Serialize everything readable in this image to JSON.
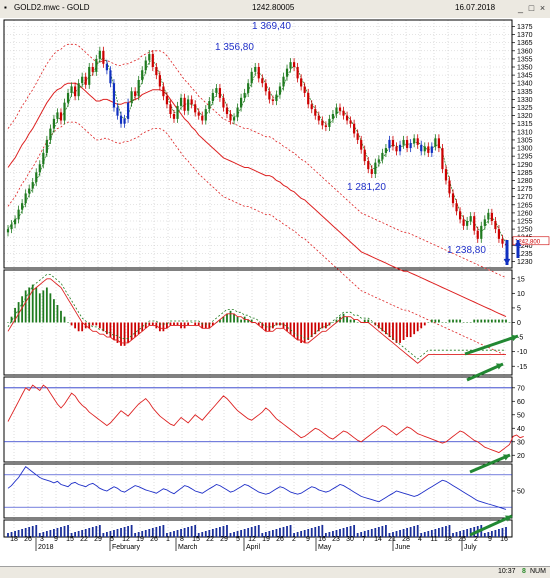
{
  "window": {
    "title": "GOLD2.mwc - GOLD",
    "price_readout": "1242.80005",
    "date_readout": "16.07.2018",
    "minimize_icon": "minimize-icon",
    "restore_icon": "restore-icon",
    "close_icon": "close-icon"
  },
  "status_bar": {
    "time": "10:37",
    "indicator_value": "8",
    "mode": "NUM"
  },
  "chart_data": [
    {
      "type": "candlestick",
      "title": "",
      "price_axis_ticks": [
        1230,
        1235,
        1240,
        1245,
        1250,
        1255,
        1260,
        1265,
        1270,
        1275,
        1280,
        1285,
        1290,
        1295,
        1300,
        1305,
        1310,
        1315,
        1320,
        1325,
        1330,
        1335,
        1340,
        1345,
        1350,
        1355,
        1360,
        1365,
        1370,
        1375
      ],
      "ylim": [
        1226,
        1379
      ],
      "current_price_label": "1242.800",
      "annotations": [
        {
          "text": "1 369,40",
          "value": 1369.4
        },
        {
          "text": "1 356,80",
          "value": 1356.8
        },
        {
          "text": "1 281,20",
          "value": 1281.2
        },
        {
          "text": "1 238,80",
          "value": 1238.8
        }
      ],
      "close": [
        1250,
        1253,
        1256,
        1262,
        1266,
        1272,
        1275,
        1279,
        1285,
        1290,
        1297,
        1305,
        1312,
        1318,
        1322,
        1317,
        1328,
        1334,
        1338,
        1332,
        1340,
        1344,
        1339,
        1350,
        1347,
        1355,
        1360,
        1352,
        1348,
        1340,
        1325,
        1320,
        1315,
        1318,
        1328,
        1335,
        1332,
        1342,
        1348,
        1354,
        1358,
        1350,
        1345,
        1338,
        1332,
        1327,
        1321,
        1318,
        1326,
        1331,
        1323,
        1330,
        1327,
        1322,
        1320,
        1317,
        1324,
        1329,
        1334,
        1337,
        1331,
        1325,
        1321,
        1317,
        1319,
        1325,
        1331,
        1334,
        1340,
        1347,
        1350,
        1343,
        1340,
        1335,
        1330,
        1329,
        1333,
        1338,
        1344,
        1349,
        1353,
        1350,
        1343,
        1338,
        1334,
        1327,
        1324,
        1320,
        1317,
        1314,
        1313,
        1318,
        1321,
        1325,
        1323,
        1320,
        1317,
        1315,
        1309,
        1305,
        1299,
        1292,
        1287,
        1284,
        1291,
        1293,
        1297,
        1300,
        1305,
        1301,
        1298,
        1302,
        1305,
        1300,
        1303,
        1306,
        1302,
        1298,
        1301,
        1297,
        1301,
        1306,
        1300,
        1287,
        1280,
        1272,
        1266,
        1261,
        1256,
        1252,
        1255,
        1258,
        1249,
        1244,
        1252,
        1256,
        1260,
        1255,
        1250,
        1244,
        1241,
        1240
      ],
      "middle_band": [
        1288,
        1291,
        1294,
        1298,
        1302,
        1305,
        1309,
        1312,
        1316,
        1320,
        1324,
        1328,
        1331,
        1334,
        1336,
        1337,
        1339,
        1340,
        1340,
        1340,
        1339,
        1337,
        1335,
        1333,
        1331,
        1329,
        1329,
        1330,
        1330,
        1329,
        1328,
        1327,
        1327,
        1328,
        1328,
        1329,
        1330,
        1331,
        1333,
        1334,
        1335,
        1336,
        1336,
        1336,
        1335,
        1333,
        1330,
        1327,
        1324,
        1321,
        1318,
        1316,
        1313,
        1311,
        1308,
        1306,
        1304,
        1302,
        1300,
        1298,
        1296,
        1294,
        1293,
        1292,
        1291,
        1290,
        1289,
        1288,
        1288,
        1287,
        1286,
        1285,
        1284,
        1283,
        1283,
        1282,
        1280,
        1279,
        1277,
        1276,
        1274,
        1273,
        1271,
        1269,
        1268,
        1266,
        1264,
        1262,
        1260,
        1258,
        1256,
        1254,
        1252,
        1250,
        1248,
        1246,
        1244,
        1242,
        1240,
        1238,
        1236,
        1235,
        1234,
        1233,
        1232,
        1231,
        1230,
        1229,
        1228,
        1227,
        1226,
        1225,
        1224,
        1224,
        1223,
        1222,
        1221,
        1220,
        1219,
        1218,
        1217,
        1216,
        1215,
        1214,
        1213,
        1212,
        1211,
        1210,
        1209,
        1208,
        1207,
        1206,
        1205,
        1204,
        1203,
        1202,
        1201,
        1200,
        1199,
        1198,
        1197,
        1196
      ]
    },
    {
      "type": "histogram",
      "name": "oscillator",
      "y_ticks": [
        15,
        10,
        5,
        0,
        -5,
        -10,
        -15
      ],
      "ylim": [
        -18,
        18
      ],
      "histogram": [
        0,
        2,
        5,
        7,
        9,
        11,
        12,
        13,
        12,
        10,
        11,
        12,
        10,
        8,
        6,
        4,
        2,
        0,
        -1,
        -2,
        -3,
        -3,
        -2,
        -2,
        -1,
        -1,
        -2,
        -3,
        -4,
        -5,
        -6,
        -7,
        -8,
        -8,
        -7,
        -6,
        -5,
        -4,
        -3,
        -2,
        -1,
        -1,
        -2,
        -3,
        -3,
        -2,
        -1,
        -1,
        -1,
        -2,
        -2,
        -1,
        0,
        -1,
        -1,
        -2,
        -2,
        -2,
        -1,
        0,
        1,
        2,
        3,
        4,
        3,
        2,
        1,
        2,
        1,
        1,
        0,
        -1,
        -2,
        -3,
        -3,
        -2,
        -1,
        -1,
        -2,
        -3,
        -4,
        -5,
        -6,
        -7,
        -7,
        -6,
        -5,
        -4,
        -3,
        -2,
        -2,
        -1,
        0,
        1,
        2,
        3,
        2,
        1,
        1,
        0,
        0,
        1,
        1,
        0,
        -1,
        -2,
        -3,
        -4,
        -5,
        -6,
        -7,
        -7,
        -6,
        -5,
        -5,
        -4,
        -3,
        -2,
        -1,
        0,
        1,
        1,
        1,
        0,
        0,
        1,
        1,
        1,
        1,
        0,
        0,
        0,
        1,
        1,
        1,
        1,
        1,
        1,
        1,
        1,
        1,
        1,
        0
      ],
      "signal": [
        -3,
        -1,
        1,
        3,
        5,
        7,
        9,
        11,
        12,
        13,
        14,
        15,
        15,
        14,
        13,
        12,
        10,
        8,
        6,
        4,
        2,
        0,
        -1,
        -2,
        -3,
        -3,
        -4,
        -4,
        -5,
        -5,
        -6,
        -6,
        -7,
        -7,
        -7,
        -6,
        -5,
        -4,
        -3,
        -2,
        -1,
        -1,
        -1,
        -2,
        -2,
        -2,
        -1,
        -1,
        -1,
        -1,
        -1,
        -1,
        -1,
        -1,
        -1,
        -2,
        -2,
        -2,
        -1,
        0,
        1,
        2,
        3,
        3,
        3,
        2,
        2,
        1,
        1,
        0,
        0,
        -1,
        -2,
        -3,
        -3,
        -3,
        -2,
        -2,
        -2,
        -3,
        -4,
        -5,
        -6,
        -6,
        -7,
        -7,
        -6,
        -5,
        -4,
        -3,
        -3,
        -2,
        -1,
        0,
        1,
        2,
        2,
        2,
        1,
        1,
        0,
        0,
        0,
        -1,
        -2,
        -3,
        -4,
        -5,
        -6,
        -7,
        -8,
        -9,
        -10,
        -11,
        -12,
        -13,
        -14,
        -13,
        -12,
        -11,
        -11,
        -11,
        -11,
        -11,
        -11,
        -11,
        -11,
        -11,
        -11,
        -11,
        -11,
        -11,
        -11,
        -11,
        -11,
        -11,
        -11,
        -11,
        -11,
        -11,
        -11,
        -11
      ]
    },
    {
      "type": "line",
      "name": "rsi",
      "y_ticks": [
        70,
        60,
        50,
        40,
        30,
        20
      ],
      "ylim": [
        15,
        78
      ],
      "levels": [
        70,
        30
      ],
      "values": [
        45,
        50,
        55,
        60,
        65,
        70,
        68,
        72,
        70,
        68,
        72,
        70,
        66,
        62,
        58,
        55,
        58,
        62,
        66,
        64,
        60,
        57,
        55,
        52,
        50,
        48,
        46,
        44,
        42,
        44,
        47,
        50,
        53,
        51,
        49,
        52,
        55,
        58,
        60,
        62,
        59,
        55,
        52,
        49,
        47,
        45,
        43,
        42,
        45,
        48,
        46,
        44,
        47,
        50,
        48,
        46,
        49,
        52,
        55,
        58,
        61,
        64,
        62,
        59,
        56,
        53,
        51,
        49,
        47,
        46,
        48,
        50,
        52,
        55,
        53,
        50,
        47,
        45,
        43,
        41,
        39,
        37,
        35,
        33,
        34,
        36,
        38,
        40,
        39,
        37,
        35,
        33,
        32,
        34,
        36,
        38,
        37,
        35,
        33,
        31,
        30,
        32,
        34,
        36,
        38,
        40,
        42,
        41,
        39,
        37,
        35,
        37,
        39,
        41,
        40,
        38,
        36,
        35,
        34,
        33,
        32,
        31,
        30,
        29,
        30,
        32,
        34,
        36,
        38,
        37,
        35,
        33,
        31,
        30,
        28,
        26,
        25,
        24,
        23,
        22,
        24,
        26,
        28,
        34,
        35,
        33,
        34
      ]
    },
    {
      "type": "line",
      "name": "stochastic",
      "y_ticks": [
        50
      ],
      "ylim": [
        0,
        100
      ],
      "values": [
        55,
        60,
        68,
        75,
        85,
        95,
        90,
        85,
        80,
        75,
        72,
        70,
        68,
        65,
        68,
        62,
        60,
        58,
        64,
        66,
        62,
        60,
        58,
        62,
        64,
        60,
        55,
        52,
        50,
        54,
        58,
        55,
        50,
        48,
        52,
        56,
        60,
        58,
        55,
        52,
        50,
        48,
        46,
        50,
        54,
        52,
        48,
        45,
        50,
        55,
        60,
        58,
        54,
        50,
        48,
        46,
        50,
        54,
        58,
        62,
        60,
        56,
        52,
        48,
        50,
        54,
        58,
        62,
        60,
        56,
        52,
        48,
        46,
        44,
        46,
        50,
        54,
        58,
        56,
        52,
        48,
        46,
        44,
        46,
        50,
        54,
        58,
        56,
        52,
        50,
        48,
        50,
        54,
        58,
        62,
        60,
        56,
        52,
        48,
        44,
        40,
        38,
        36,
        34,
        32,
        30,
        34,
        38,
        42,
        46,
        50,
        48,
        46,
        44,
        42,
        40,
        42,
        46,
        50,
        54,
        58,
        62,
        66,
        70,
        68,
        64,
        60,
        56,
        52,
        48,
        44,
        40,
        36,
        32,
        30,
        28,
        26,
        24,
        22,
        20,
        18,
        16
      ]
    }
  ],
  "x_axis": {
    "day_labels": [
      "18",
      "26",
      "3",
      "9",
      "15",
      "22",
      "29",
      "5",
      "12",
      "19",
      "26",
      "1",
      "8",
      "15",
      "22",
      "29",
      "5",
      "12",
      "19",
      "26",
      "2",
      "9",
      "16",
      "23",
      "30",
      "7",
      "14",
      "21",
      "28",
      "4",
      "11",
      "18",
      "25",
      "2",
      "9",
      "16"
    ],
    "month_labels": [
      "2018",
      "February",
      "March",
      "April",
      "May",
      "June",
      "July"
    ]
  },
  "colors": {
    "bullish": "#1f7a1f",
    "bearish": "#cc0000",
    "blue_candle": "#1030c0",
    "red_line": "#dd2222",
    "blue_line": "#2030c8",
    "green_arrow": "#228833",
    "blue_arrow": "#1030c0"
  }
}
